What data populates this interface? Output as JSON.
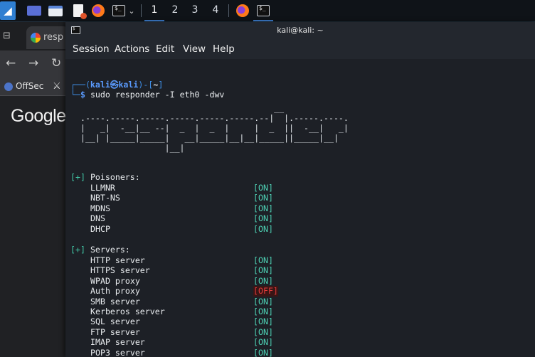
{
  "taskbar": {
    "workspaces": [
      "1",
      "2",
      "3",
      "4"
    ],
    "icons": [
      "kali-menu-icon",
      "desktop-icon",
      "file-manager-icon",
      "text-editor-icon",
      "firefox-icon",
      "terminal-icon",
      "firefox-icon",
      "terminal-icon"
    ]
  },
  "browser": {
    "tab_title": "resp",
    "bookmark_label": "OffSec",
    "google_text": "Google"
  },
  "terminal": {
    "title": "kali@kali: ~",
    "menu": [
      "Session",
      "Actions",
      "Edit",
      "View",
      "Help"
    ],
    "prompt": {
      "top_prefix": "┌──(",
      "user": "kali",
      "at": "㉿",
      "host": "kali",
      "dir_open": ")-[",
      "dir": "~",
      "dir_close": "]",
      "bottom_prefix": "└─",
      "symbol": "$",
      "command": "sudo responder -I eth0 -dwv"
    },
    "banner": [
      "                                         __",
      "  .----.-----.-----.-----.-----.-----.--|  |.-----.----.",
      "  |   _|  -__|__ --|  _  |  _  |     |  _  ||  -__|   _|",
      "  |__| |_____|_____|   __|_____|__|__|_____||_____|__|",
      "                   |__|"
    ],
    "poisoners_heading": "Poisoners:",
    "poisoners": [
      {
        "name": "LLMNR",
        "status": "[ON]"
      },
      {
        "name": "NBT-NS",
        "status": "[ON]"
      },
      {
        "name": "MDNS",
        "status": "[ON]"
      },
      {
        "name": "DNS",
        "status": "[ON]"
      },
      {
        "name": "DHCP",
        "status": "[ON]"
      }
    ],
    "servers_heading": "Servers:",
    "servers": [
      {
        "name": "HTTP server",
        "status": "[ON]"
      },
      {
        "name": "HTTPS server",
        "status": "[ON]"
      },
      {
        "name": "WPAD proxy",
        "status": "[ON]"
      },
      {
        "name": "Auth proxy",
        "status": "[OFF]"
      },
      {
        "name": "SMB server",
        "status": "[ON]"
      },
      {
        "name": "Kerberos server",
        "status": "[ON]"
      },
      {
        "name": "SQL server",
        "status": "[ON]"
      },
      {
        "name": "FTP server",
        "status": "[ON]"
      },
      {
        "name": "IMAP server",
        "status": "[ON]"
      },
      {
        "name": "POP3 server",
        "status": "[ON]"
      }
    ],
    "bullet": "[+]"
  },
  "colors": {
    "status_on": "#4ed2b5",
    "status_off": "#e23b3b",
    "prompt_blue": "#3e8ee6",
    "accent": "#3d7fcf"
  }
}
